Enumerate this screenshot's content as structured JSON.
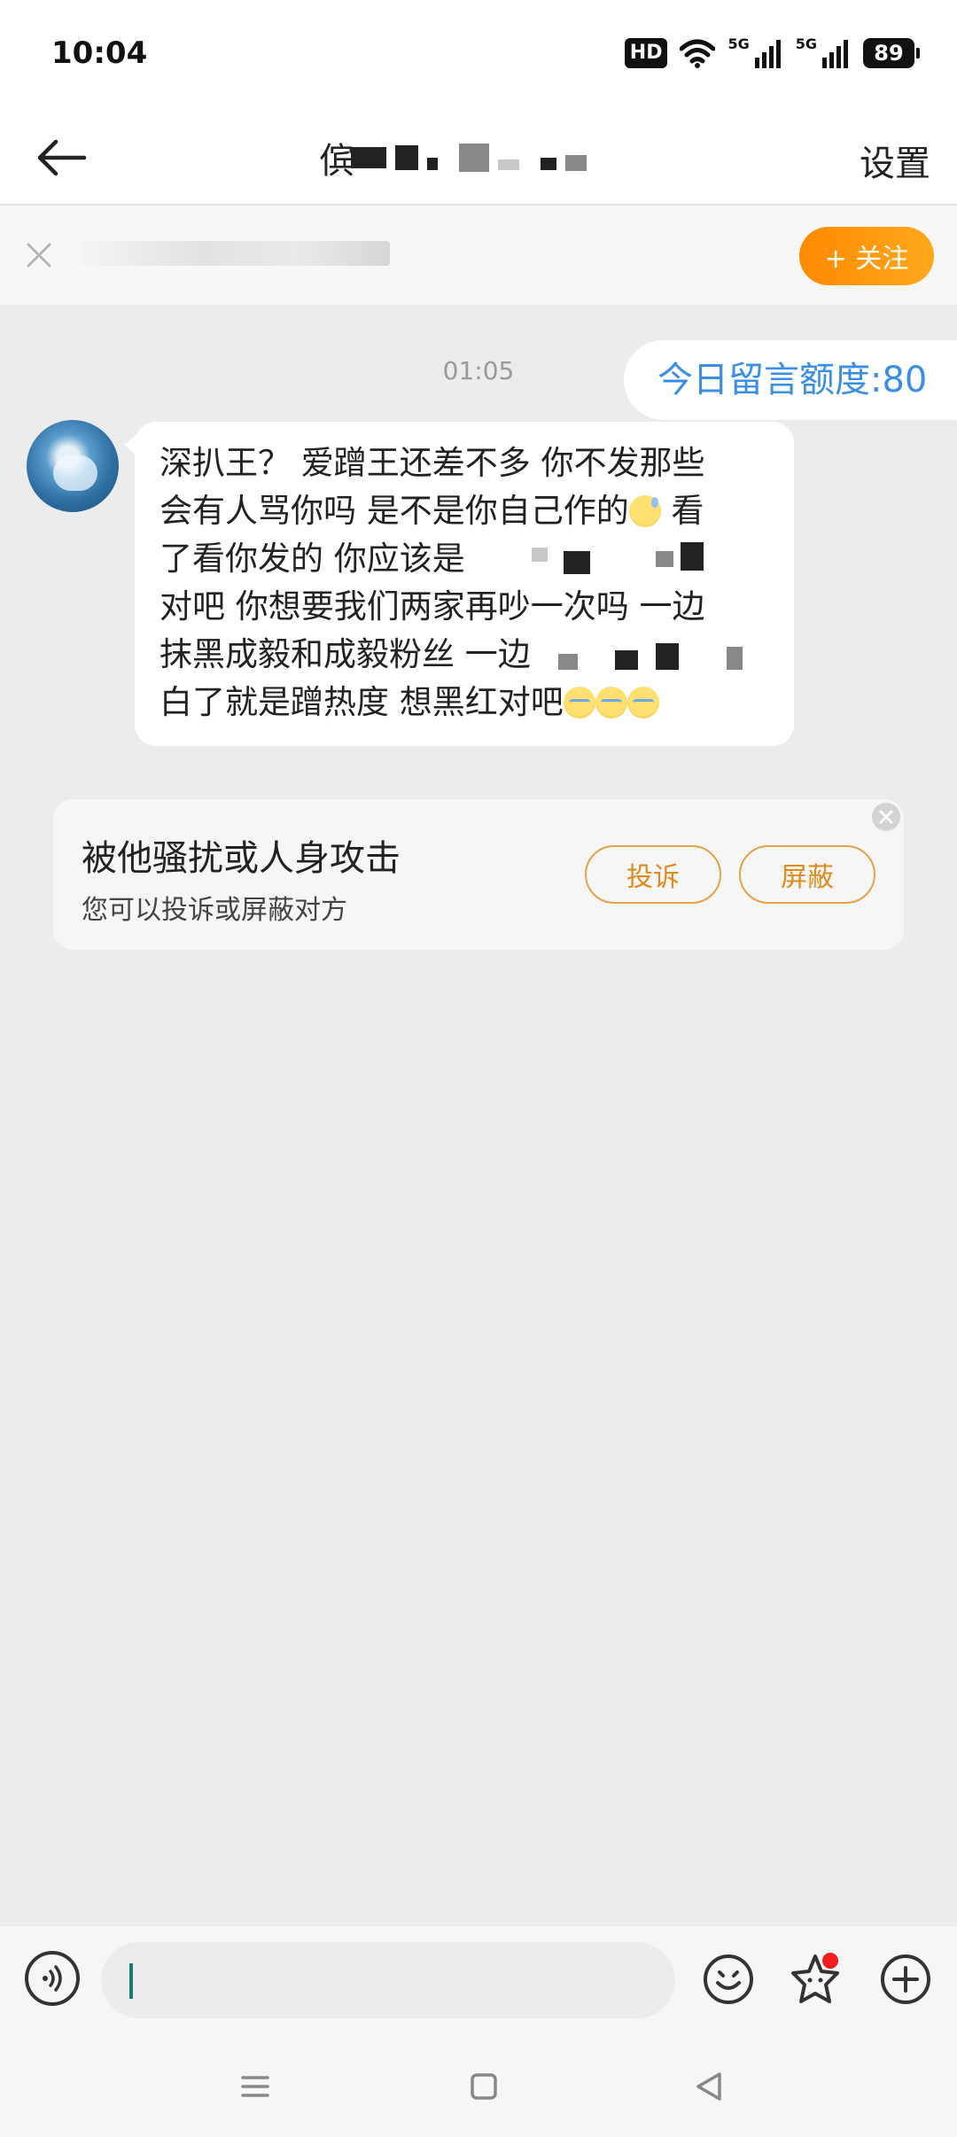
{
  "status_bar": {
    "time": "10:04",
    "hd_label": "HD",
    "sim_labels": [
      "5G",
      "5G"
    ],
    "battery": "89"
  },
  "header": {
    "title_visible_char": "傧",
    "settings_label": "设置"
  },
  "follow_banner": {
    "follow_label": "+ 关注"
  },
  "chat": {
    "quota_text": "今日留言额度:80",
    "timestamp": "01:05",
    "message_lines": [
      "深扒王？ 爱蹭王还差不多 你不发那些",
      "会有人骂你吗 是不是你自己作的",
      "看",
      "了看你发的 你应该是",
      "对吧 你想要我们两家再吵一次吗 一边",
      "抹黑成毅和成毅粉丝 一边",
      "白了就是蹭热度 想黑红对吧"
    ]
  },
  "report_card": {
    "title": "被他骚扰或人身攻击",
    "subtitle": "您可以投诉或屏蔽对方",
    "complain_label": "投诉",
    "block_label": "屏蔽"
  },
  "input_bar": {
    "placeholder": ""
  },
  "colors": {
    "accent_orange": "#ff8a00",
    "quota_blue": "#3a8ee6",
    "background": "#ececec"
  }
}
